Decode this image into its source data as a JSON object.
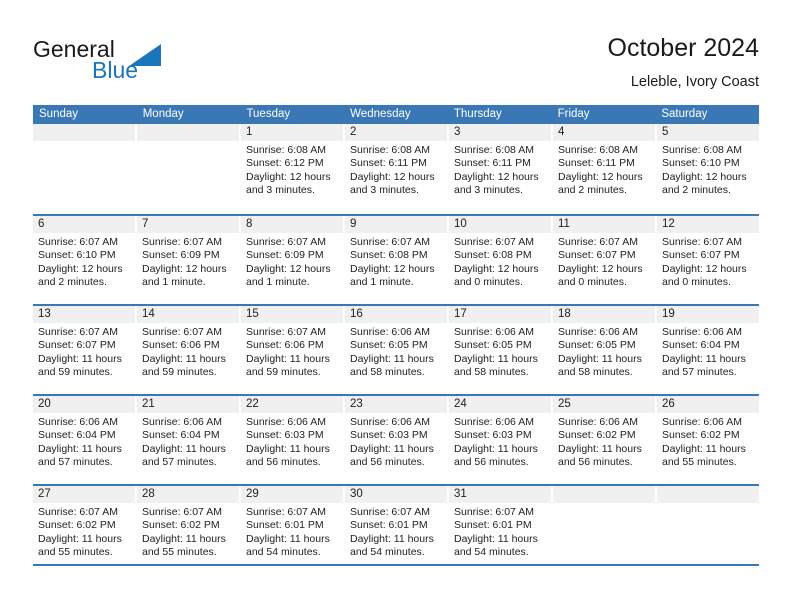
{
  "logo": {
    "word_one": "General",
    "word_two": "Blue",
    "accent_color": "#1b75bb",
    "triangle_icon": "triangle-icon"
  },
  "header": {
    "title": "October 2024",
    "subtitle": "Leleble, Ivory Coast"
  },
  "theme": {
    "header_band": "#3a78b5",
    "date_band": "#f0f0f0",
    "text": "#222222"
  },
  "weekdays": [
    "Sunday",
    "Monday",
    "Tuesday",
    "Wednesday",
    "Thursday",
    "Friday",
    "Saturday"
  ],
  "weeks": [
    [
      {
        "day": "",
        "sunrise": "",
        "sunset": "",
        "daylight_line1": "",
        "daylight_line2": ""
      },
      {
        "day": "",
        "sunrise": "",
        "sunset": "",
        "daylight_line1": "",
        "daylight_line2": ""
      },
      {
        "day": "1",
        "sunrise": "Sunrise: 6:08 AM",
        "sunset": "Sunset: 6:12 PM",
        "daylight_line1": "Daylight: 12 hours",
        "daylight_line2": "and 3 minutes."
      },
      {
        "day": "2",
        "sunrise": "Sunrise: 6:08 AM",
        "sunset": "Sunset: 6:11 PM",
        "daylight_line1": "Daylight: 12 hours",
        "daylight_line2": "and 3 minutes."
      },
      {
        "day": "3",
        "sunrise": "Sunrise: 6:08 AM",
        "sunset": "Sunset: 6:11 PM",
        "daylight_line1": "Daylight: 12 hours",
        "daylight_line2": "and 3 minutes."
      },
      {
        "day": "4",
        "sunrise": "Sunrise: 6:08 AM",
        "sunset": "Sunset: 6:11 PM",
        "daylight_line1": "Daylight: 12 hours",
        "daylight_line2": "and 2 minutes."
      },
      {
        "day": "5",
        "sunrise": "Sunrise: 6:08 AM",
        "sunset": "Sunset: 6:10 PM",
        "daylight_line1": "Daylight: 12 hours",
        "daylight_line2": "and 2 minutes."
      }
    ],
    [
      {
        "day": "6",
        "sunrise": "Sunrise: 6:07 AM",
        "sunset": "Sunset: 6:10 PM",
        "daylight_line1": "Daylight: 12 hours",
        "daylight_line2": "and 2 minutes."
      },
      {
        "day": "7",
        "sunrise": "Sunrise: 6:07 AM",
        "sunset": "Sunset: 6:09 PM",
        "daylight_line1": "Daylight: 12 hours",
        "daylight_line2": "and 1 minute."
      },
      {
        "day": "8",
        "sunrise": "Sunrise: 6:07 AM",
        "sunset": "Sunset: 6:09 PM",
        "daylight_line1": "Daylight: 12 hours",
        "daylight_line2": "and 1 minute."
      },
      {
        "day": "9",
        "sunrise": "Sunrise: 6:07 AM",
        "sunset": "Sunset: 6:08 PM",
        "daylight_line1": "Daylight: 12 hours",
        "daylight_line2": "and 1 minute."
      },
      {
        "day": "10",
        "sunrise": "Sunrise: 6:07 AM",
        "sunset": "Sunset: 6:08 PM",
        "daylight_line1": "Daylight: 12 hours",
        "daylight_line2": "and 0 minutes."
      },
      {
        "day": "11",
        "sunrise": "Sunrise: 6:07 AM",
        "sunset": "Sunset: 6:07 PM",
        "daylight_line1": "Daylight: 12 hours",
        "daylight_line2": "and 0 minutes."
      },
      {
        "day": "12",
        "sunrise": "Sunrise: 6:07 AM",
        "sunset": "Sunset: 6:07 PM",
        "daylight_line1": "Daylight: 12 hours",
        "daylight_line2": "and 0 minutes."
      }
    ],
    [
      {
        "day": "13",
        "sunrise": "Sunrise: 6:07 AM",
        "sunset": "Sunset: 6:07 PM",
        "daylight_line1": "Daylight: 11 hours",
        "daylight_line2": "and 59 minutes."
      },
      {
        "day": "14",
        "sunrise": "Sunrise: 6:07 AM",
        "sunset": "Sunset: 6:06 PM",
        "daylight_line1": "Daylight: 11 hours",
        "daylight_line2": "and 59 minutes."
      },
      {
        "day": "15",
        "sunrise": "Sunrise: 6:07 AM",
        "sunset": "Sunset: 6:06 PM",
        "daylight_line1": "Daylight: 11 hours",
        "daylight_line2": "and 59 minutes."
      },
      {
        "day": "16",
        "sunrise": "Sunrise: 6:06 AM",
        "sunset": "Sunset: 6:05 PM",
        "daylight_line1": "Daylight: 11 hours",
        "daylight_line2": "and 58 minutes."
      },
      {
        "day": "17",
        "sunrise": "Sunrise: 6:06 AM",
        "sunset": "Sunset: 6:05 PM",
        "daylight_line1": "Daylight: 11 hours",
        "daylight_line2": "and 58 minutes."
      },
      {
        "day": "18",
        "sunrise": "Sunrise: 6:06 AM",
        "sunset": "Sunset: 6:05 PM",
        "daylight_line1": "Daylight: 11 hours",
        "daylight_line2": "and 58 minutes."
      },
      {
        "day": "19",
        "sunrise": "Sunrise: 6:06 AM",
        "sunset": "Sunset: 6:04 PM",
        "daylight_line1": "Daylight: 11 hours",
        "daylight_line2": "and 57 minutes."
      }
    ],
    [
      {
        "day": "20",
        "sunrise": "Sunrise: 6:06 AM",
        "sunset": "Sunset: 6:04 PM",
        "daylight_line1": "Daylight: 11 hours",
        "daylight_line2": "and 57 minutes."
      },
      {
        "day": "21",
        "sunrise": "Sunrise: 6:06 AM",
        "sunset": "Sunset: 6:04 PM",
        "daylight_line1": "Daylight: 11 hours",
        "daylight_line2": "and 57 minutes."
      },
      {
        "day": "22",
        "sunrise": "Sunrise: 6:06 AM",
        "sunset": "Sunset: 6:03 PM",
        "daylight_line1": "Daylight: 11 hours",
        "daylight_line2": "and 56 minutes."
      },
      {
        "day": "23",
        "sunrise": "Sunrise: 6:06 AM",
        "sunset": "Sunset: 6:03 PM",
        "daylight_line1": "Daylight: 11 hours",
        "daylight_line2": "and 56 minutes."
      },
      {
        "day": "24",
        "sunrise": "Sunrise: 6:06 AM",
        "sunset": "Sunset: 6:03 PM",
        "daylight_line1": "Daylight: 11 hours",
        "daylight_line2": "and 56 minutes."
      },
      {
        "day": "25",
        "sunrise": "Sunrise: 6:06 AM",
        "sunset": "Sunset: 6:02 PM",
        "daylight_line1": "Daylight: 11 hours",
        "daylight_line2": "and 56 minutes."
      },
      {
        "day": "26",
        "sunrise": "Sunrise: 6:06 AM",
        "sunset": "Sunset: 6:02 PM",
        "daylight_line1": "Daylight: 11 hours",
        "daylight_line2": "and 55 minutes."
      }
    ],
    [
      {
        "day": "27",
        "sunrise": "Sunrise: 6:07 AM",
        "sunset": "Sunset: 6:02 PM",
        "daylight_line1": "Daylight: 11 hours",
        "daylight_line2": "and 55 minutes."
      },
      {
        "day": "28",
        "sunrise": "Sunrise: 6:07 AM",
        "sunset": "Sunset: 6:02 PM",
        "daylight_line1": "Daylight: 11 hours",
        "daylight_line2": "and 55 minutes."
      },
      {
        "day": "29",
        "sunrise": "Sunrise: 6:07 AM",
        "sunset": "Sunset: 6:01 PM",
        "daylight_line1": "Daylight: 11 hours",
        "daylight_line2": "and 54 minutes."
      },
      {
        "day": "30",
        "sunrise": "Sunrise: 6:07 AM",
        "sunset": "Sunset: 6:01 PM",
        "daylight_line1": "Daylight: 11 hours",
        "daylight_line2": "and 54 minutes."
      },
      {
        "day": "31",
        "sunrise": "Sunrise: 6:07 AM",
        "sunset": "Sunset: 6:01 PM",
        "daylight_line1": "Daylight: 11 hours",
        "daylight_line2": "and 54 minutes."
      },
      {
        "day": "",
        "sunrise": "",
        "sunset": "",
        "daylight_line1": "",
        "daylight_line2": ""
      },
      {
        "day": "",
        "sunrise": "",
        "sunset": "",
        "daylight_line1": "",
        "daylight_line2": ""
      }
    ]
  ]
}
